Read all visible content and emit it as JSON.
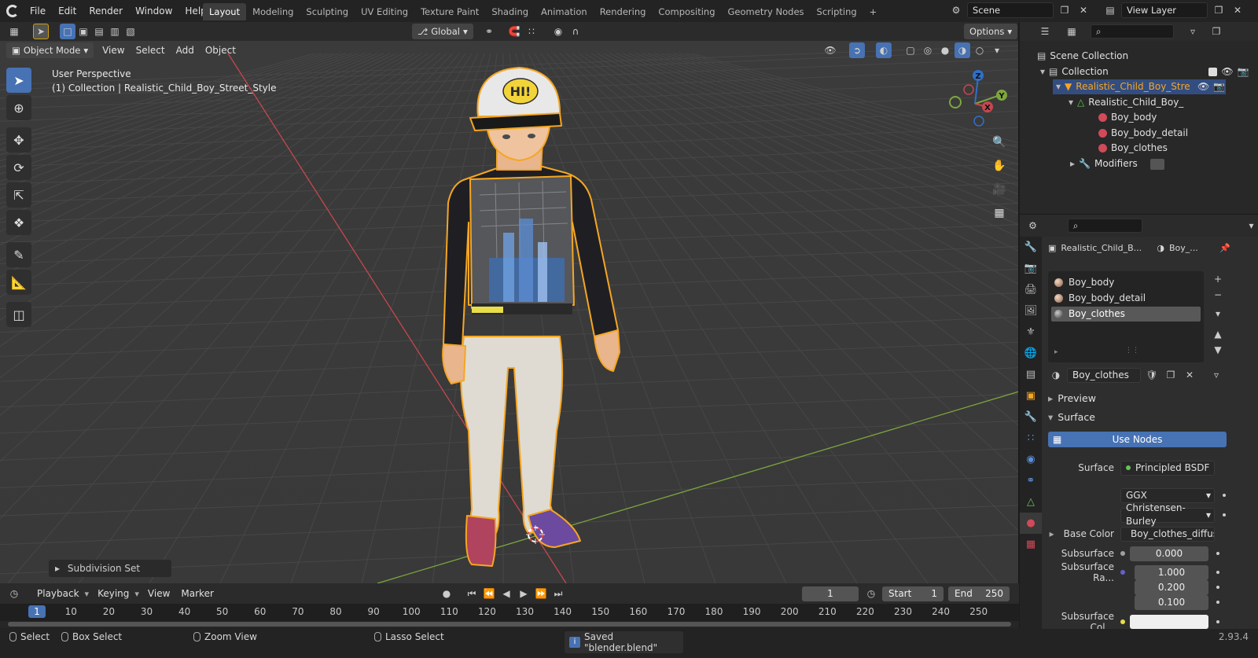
{
  "topbar": {
    "menus": [
      "File",
      "Edit",
      "Render",
      "Window",
      "Help"
    ],
    "workspaces": [
      "Layout",
      "Modeling",
      "Sculpting",
      "UV Editing",
      "Texture Paint",
      "Shading",
      "Animation",
      "Rendering",
      "Compositing",
      "Geometry Nodes",
      "Scripting"
    ],
    "active_workspace": "Layout",
    "scene": "Scene",
    "view_layer": "View Layer"
  },
  "viewport": {
    "transform_orientation": "Global",
    "options_label": "Options",
    "mode": "Object Mode",
    "menus": [
      "View",
      "Select",
      "Add",
      "Object"
    ],
    "perspective": "User Perspective",
    "collection_info": "(1) Collection | Realistic_Child_Boy_Street_Style",
    "last_operator": "Subdivision Set",
    "gizmo_axes": {
      "z": "Z",
      "y": "Y",
      "x": "X"
    },
    "cap_text": "HI!"
  },
  "timeline": {
    "menus": [
      "Playback",
      "Keying",
      "View",
      "Marker"
    ],
    "current_frame": "1",
    "start_label": "Start",
    "start": "1",
    "end_label": "End",
    "end": "250",
    "ruler_ticks": [
      "1",
      "10",
      "20",
      "30",
      "40",
      "50",
      "60",
      "70",
      "80",
      "90",
      "100",
      "110",
      "120",
      "130",
      "140",
      "150",
      "160",
      "170",
      "180",
      "190",
      "200",
      "210",
      "220",
      "230",
      "240",
      "250"
    ]
  },
  "statusbar": {
    "select": "Select",
    "box_select": "Box Select",
    "zoom_view": "Zoom View",
    "lasso_select": "Lasso Select",
    "message": "Saved \"blender.blend\"",
    "version": "2.93.4"
  },
  "outliner": {
    "scene_collection": "Scene Collection",
    "collection": "Collection",
    "object": "Realistic_Child_Boy_Stre",
    "mesh": "Realistic_Child_Boy_",
    "materials": [
      "Boy_body",
      "Boy_body_detail",
      "Boy_clothes"
    ],
    "modifiers": "Modifiers"
  },
  "properties": {
    "object_name": "Realistic_Child_B...",
    "material_short": "Boy_...",
    "slots": [
      "Boy_body",
      "Boy_body_detail",
      "Boy_clothes"
    ],
    "active_slot": "Boy_clothes",
    "material_name": "Boy_clothes",
    "sections": {
      "preview": "Preview",
      "surface": "Surface"
    },
    "use_nodes_label": "Use Nodes",
    "surface_label": "Surface",
    "surface_value": "Principled BSDF",
    "distribution": "GGX",
    "subsurface_method": "Christensen-Burley",
    "base_color_label": "Base Color",
    "base_color_value": "Boy_clothes_diffus...",
    "subsurface_label": "Subsurface",
    "subsurface_value": "0.000",
    "subsurface_radius_label": "Subsurface Ra...",
    "subsurface_radius": [
      "1.000",
      "0.200",
      "0.100"
    ],
    "subsurface_color_label": "Subsurface Col..."
  },
  "colors": {
    "accent": "#4772b3",
    "selected_outline": "#f5a623",
    "axis_x": "#c6474f",
    "axis_y": "#7ea63d"
  }
}
